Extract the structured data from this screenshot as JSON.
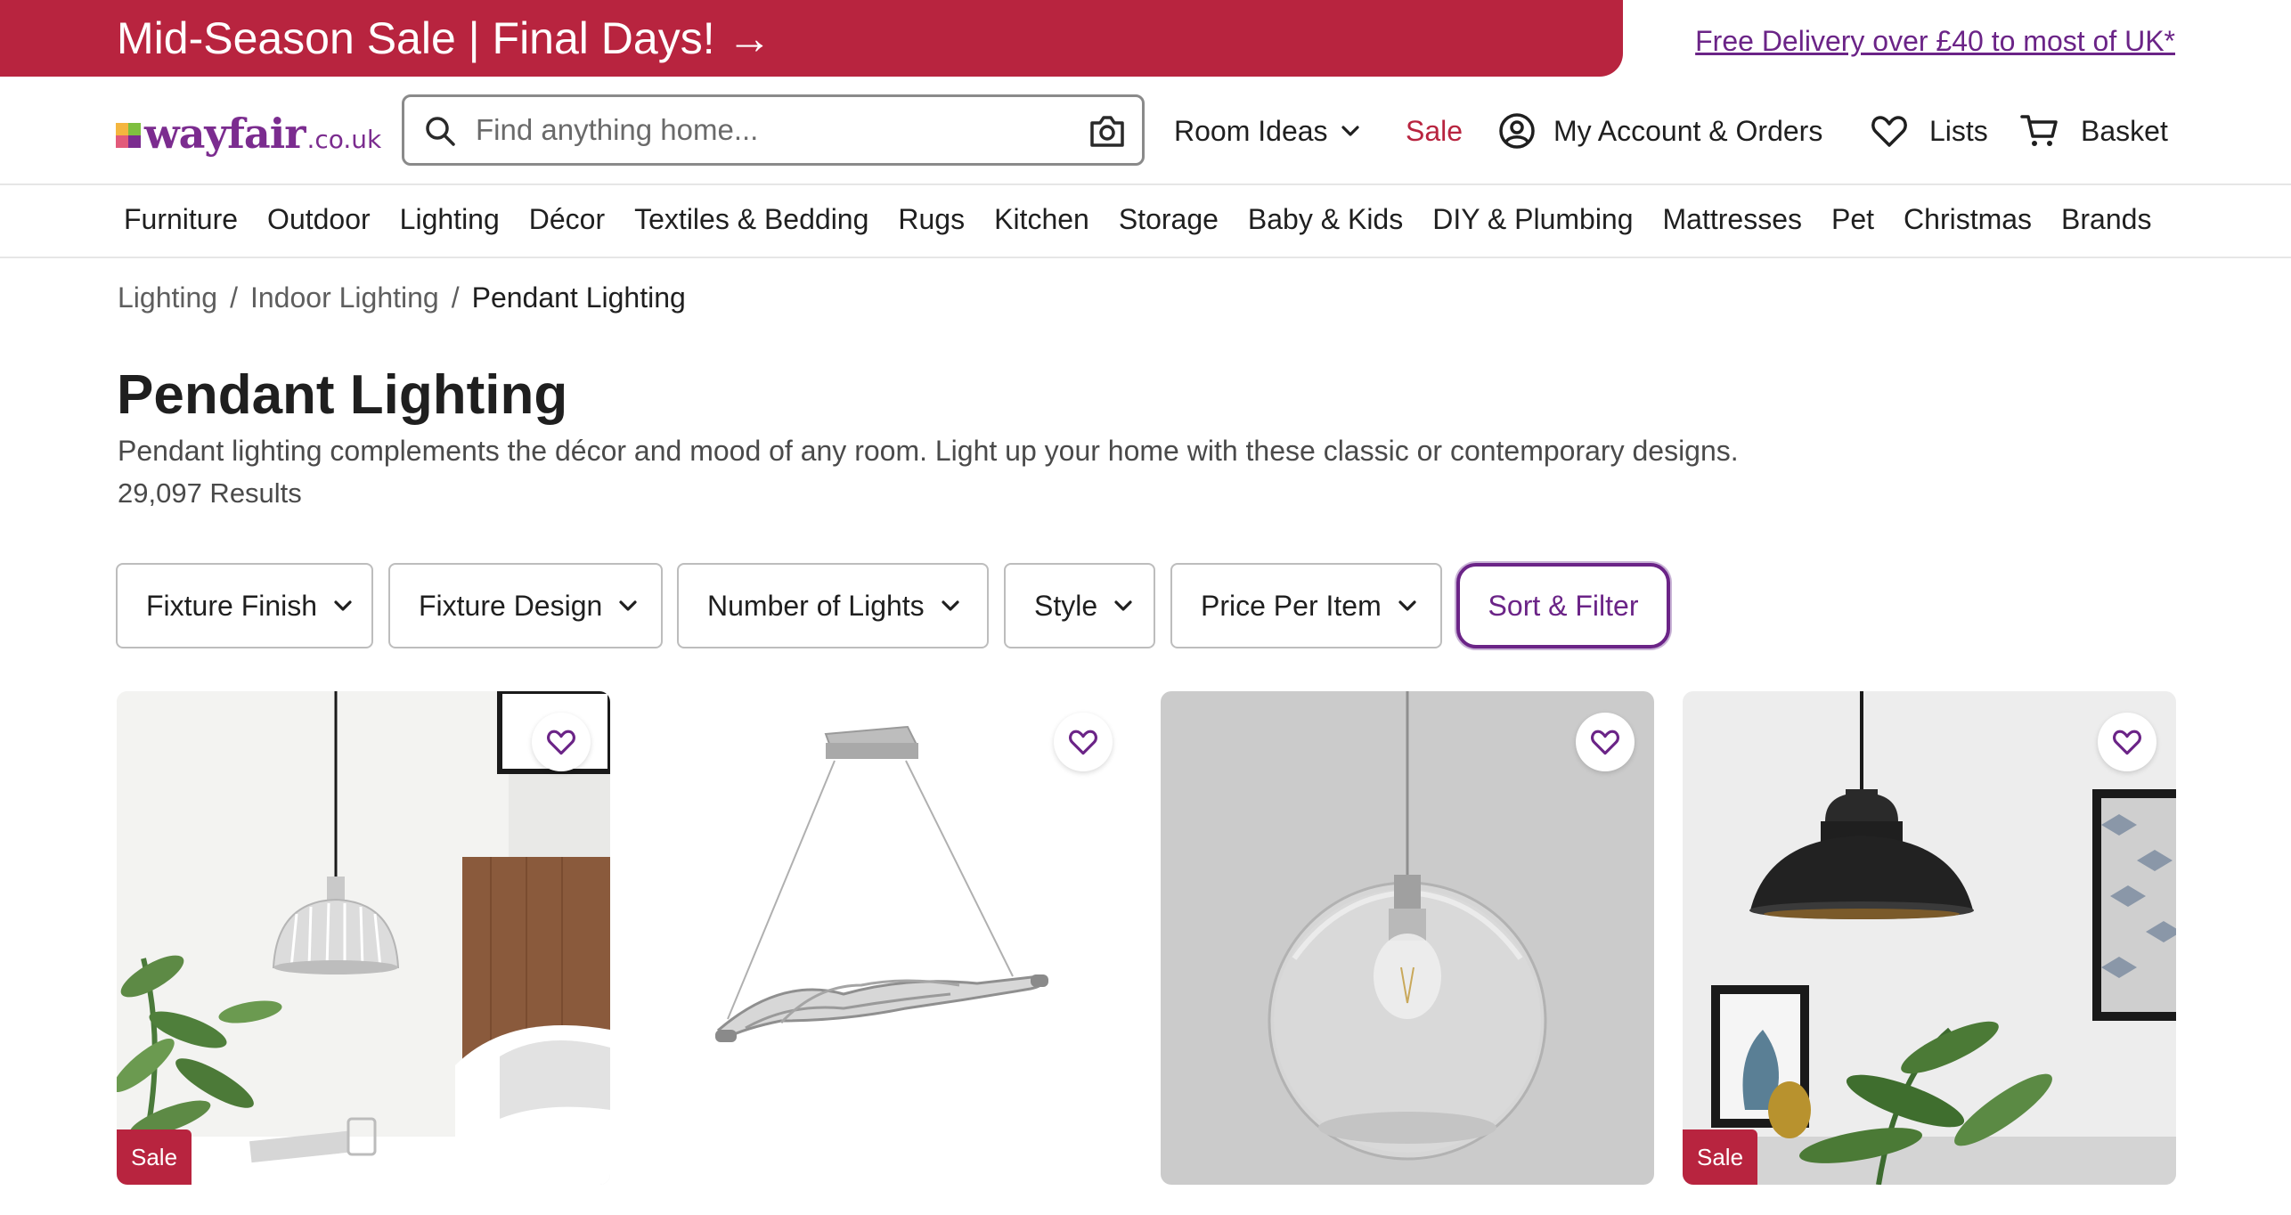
{
  "promo": {
    "text": "Mid-Season Sale | Final Days! →",
    "delivery_link": "Free Delivery over £40 to most of UK*"
  },
  "header": {
    "logo_word": "wayfair",
    "logo_tld": ".co.uk",
    "search_placeholder": "Find anything home...",
    "room_ideas": "Room Ideas",
    "sale": "Sale",
    "account": "My Account & Orders",
    "lists": "Lists",
    "basket": "Basket"
  },
  "categories": [
    "Furniture",
    "Outdoor",
    "Lighting",
    "Décor",
    "Textiles & Bedding",
    "Rugs",
    "Kitchen",
    "Storage",
    "Baby & Kids",
    "DIY & Plumbing",
    "Mattresses",
    "Pet",
    "Christmas",
    "Brands"
  ],
  "breadcrumb": {
    "items": [
      "Lighting",
      "Indoor Lighting",
      "Pendant Lighting"
    ],
    "separator": "/"
  },
  "page": {
    "title": "Pendant Lighting",
    "description": "Pendant lighting complements the décor and mood of any room. Light up your home with these classic or contemporary designs.",
    "results": "29,097 Results"
  },
  "filters": [
    {
      "label": "Fixture Finish"
    },
    {
      "label": "Fixture Design"
    },
    {
      "label": "Number of Lights"
    },
    {
      "label": "Style"
    },
    {
      "label": "Price Per Item"
    }
  ],
  "sort_filter": "Sort & Filter",
  "products": [
    {
      "image": "glass-dome-pendant-bedroom",
      "badge": "Sale"
    },
    {
      "image": "silver-wave-bar-pendant",
      "badge": ""
    },
    {
      "image": "clear-glass-globe-pendant",
      "badge": ""
    },
    {
      "image": "black-industrial-pendant",
      "badge": "Sale"
    }
  ],
  "colors": {
    "brand_red": "#b8243f",
    "brand_purple": "#7b2c8f",
    "link_purple": "#6b2487"
  }
}
